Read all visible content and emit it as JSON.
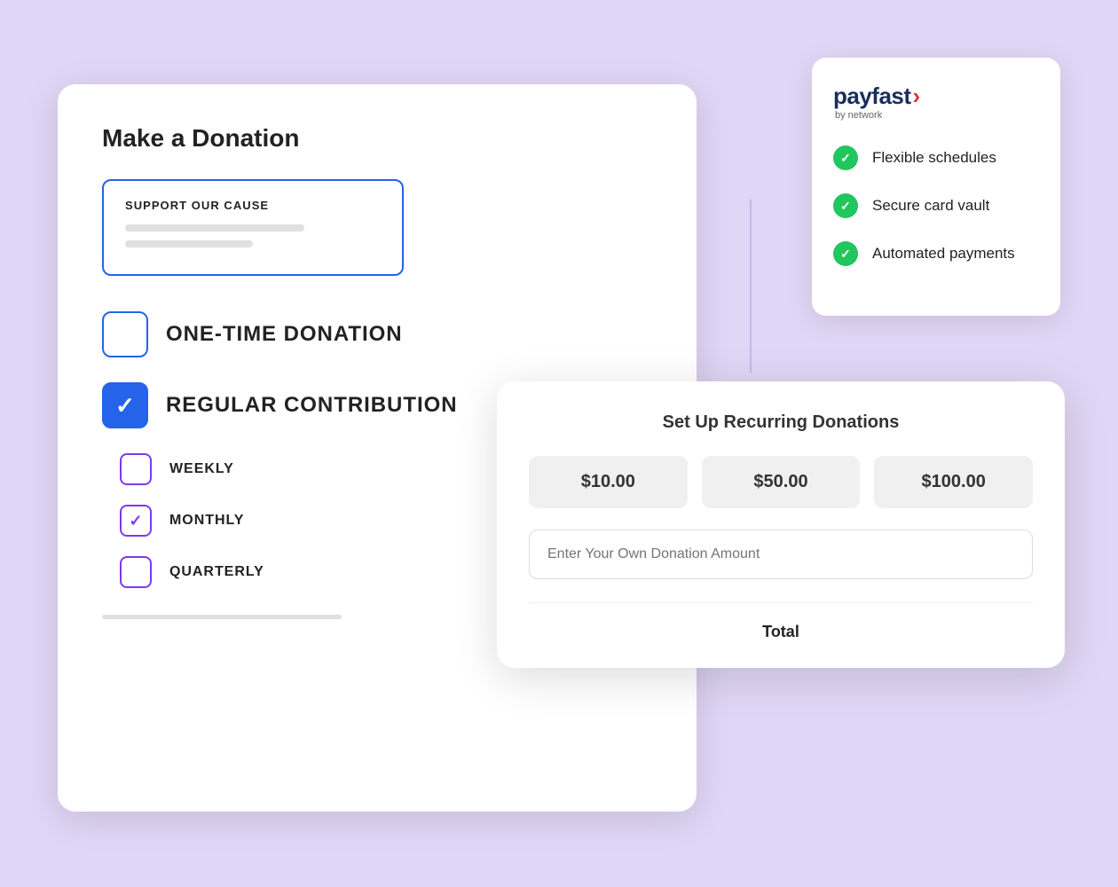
{
  "page": {
    "background_color": "#e0d6f5"
  },
  "donation_card": {
    "title": "Make a Donation",
    "cause": {
      "label": "SUPPORT OUR CAUSE"
    },
    "donation_types": [
      {
        "id": "one-time",
        "label": "ONE-TIME DONATION",
        "checked": false
      },
      {
        "id": "regular",
        "label": "REGULAR CONTRIBUTION",
        "checked": true
      }
    ],
    "frequencies": [
      {
        "id": "weekly",
        "label": "WEEKLY",
        "checked": false
      },
      {
        "id": "monthly",
        "label": "MONTHLY",
        "checked": true
      },
      {
        "id": "quarterly",
        "label": "QUARTERLY",
        "checked": false
      }
    ]
  },
  "payfast": {
    "brand": "payfast",
    "arrow": "›",
    "subtitle": "by network",
    "features": [
      {
        "text": "Flexible schedules"
      },
      {
        "text": "Secure card vault"
      },
      {
        "text": "Automated payments"
      }
    ]
  },
  "recurring_card": {
    "title": "Set Up Recurring Donations",
    "amounts": [
      {
        "label": "$10.00"
      },
      {
        "label": "$50.00"
      },
      {
        "label": "$100.00"
      }
    ],
    "custom_placeholder": "Enter Your Own Donation Amount",
    "total_label": "Total"
  }
}
